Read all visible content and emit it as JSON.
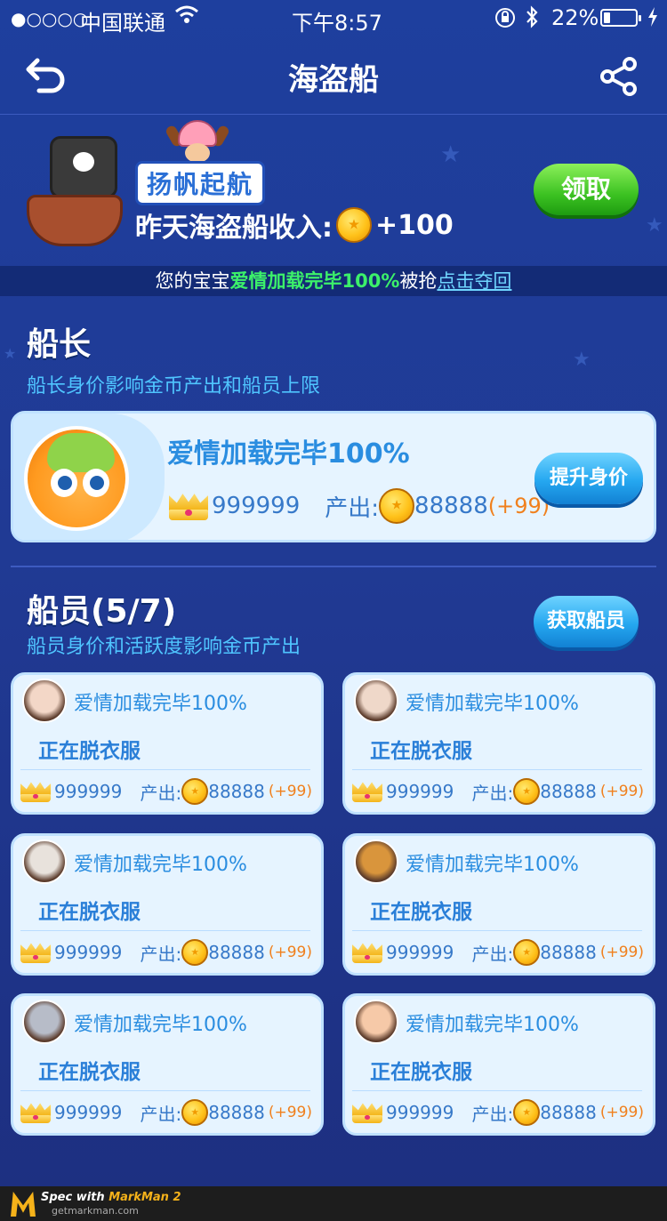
{
  "status_bar": {
    "signal": "●○○○○",
    "carrier": "中国联通",
    "time": "下午8:57",
    "battery_text": "22%",
    "battery_level": 0.22
  },
  "nav": {
    "title": "海盗船",
    "back_icon": "back-arrow-icon",
    "share_icon": "share-icon"
  },
  "banner": {
    "logo_text": "扬帆起航",
    "income_label": "昨天海盗船收入:",
    "income_value": "+100",
    "claim_label": "领取"
  },
  "notice": {
    "prefix": "您的宝宝",
    "highlight": "爱情加载完毕100%",
    "middle": "被抢",
    "link": "点击夺回"
  },
  "captain_section": {
    "title": "船长",
    "subtitle": "船长身价影响金币产出和船员上限",
    "card": {
      "name": "爱情加载完毕100%",
      "worth": "999999",
      "output_label": "产出:",
      "output_value": "88888",
      "output_bonus": "(+99)",
      "button_label": "提升身价"
    }
  },
  "crew_section": {
    "title": "船员(5/7)",
    "subtitle": "船员身价和活跃度影响金币产出",
    "button_label": "获取船员",
    "members": [
      {
        "name": "爱情加载完毕100%",
        "status": "正在脱衣服",
        "worth": "999999",
        "output_label": "产出:",
        "output_value": "88888",
        "output_bonus": "(+99)",
        "avatar_color": "#f3d7c7"
      },
      {
        "name": "爱情加载完毕100%",
        "status": "正在脱衣服",
        "worth": "999999",
        "output_label": "产出:",
        "output_value": "88888",
        "output_bonus": "(+99)",
        "avatar_color": "#efd8c9"
      },
      {
        "name": "爱情加载完毕100%",
        "status": "正在脱衣服",
        "worth": "999999",
        "output_label": "产出:",
        "output_value": "88888",
        "output_bonus": "(+99)",
        "avatar_color": "#e8e2dc"
      },
      {
        "name": "爱情加载完毕100%",
        "status": "正在脱衣服",
        "worth": "999999",
        "output_label": "产出:",
        "output_value": "88888",
        "output_bonus": "(+99)",
        "avatar_color": "#d9953c"
      },
      {
        "name": "爱情加载完毕100%",
        "status": "正在脱衣服",
        "worth": "999999",
        "output_label": "产出:",
        "output_value": "88888",
        "output_bonus": "(+99)",
        "avatar_color": "#b7bcc8"
      },
      {
        "name": "爱情加载完毕100%",
        "status": "正在脱衣服",
        "worth": "999999",
        "output_label": "产出:",
        "output_value": "88888",
        "output_bonus": "(+99)",
        "avatar_color": "#f6c9a8"
      }
    ]
  },
  "footer": {
    "line1_prefix": "Spec with ",
    "line1_brand": "MarkMan 2",
    "line2": "getmarkman.com"
  }
}
